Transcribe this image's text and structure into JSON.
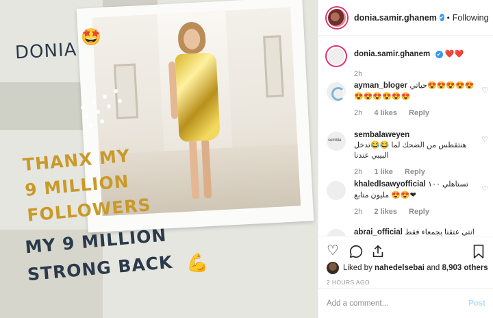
{
  "post_image": {
    "headline": "DONIA",
    "headline_emoji": "🤩",
    "thanks_lines": [
      "THANX MY",
      "9 MILLION",
      "FOLLOWERS"
    ],
    "strong_lines": [
      "MY 9 MILLION",
      "STRONG BACK"
    ],
    "strong_emoji": "💪"
  },
  "header": {
    "username": "donia.samir.ghanem",
    "verified_icon": "✔",
    "separator": "•",
    "follow_label": "Following"
  },
  "caption": {
    "username": "donia.samir.ghanem",
    "text": "❤️❤️",
    "time": "2h"
  },
  "comments": [
    {
      "user": "ayman_bloger",
      "text": "حياتي😍😍😍😍😍😍😍😍😍😍😍",
      "time": "2h",
      "likes": "4 likes",
      "reply": "Reply"
    },
    {
      "user": "sembalaweyen",
      "text": "هنتقطس من الضحك لما 😂😂تدخل البيبي عندنا",
      "time": "2h",
      "likes": "1 like",
      "reply": "Reply"
    },
    {
      "user": "khaledlsawyofficial",
      "text": "تستاهلي ١٠٠ مليون متابع 😍😍❤",
      "time": "2h",
      "likes": "2 likes",
      "reply": "Reply"
    },
    {
      "user": "abrai_official",
      "text": "انتي عتقنا بجمعاء فقط",
      "time": "",
      "likes": "",
      "reply": ""
    }
  ],
  "actions": {
    "like_icon": "heart-icon",
    "comment_icon": "comment-icon",
    "share_icon": "share-icon",
    "save_icon": "bookmark-icon"
  },
  "likes": {
    "prefix": "Liked by",
    "user": "nahedelsebai",
    "and": "and",
    "others": "8,903 others"
  },
  "time_ago": "2 HOURS AGO",
  "add_comment": {
    "placeholder": "Add a comment...",
    "post_label": "Post"
  },
  "colors": {
    "verified": "#3897f0",
    "story_ring": "#e1306c",
    "post_button_disabled": "#b2dffc",
    "gold_text": "#c99a2a",
    "navy_text": "#2b3a4a"
  }
}
